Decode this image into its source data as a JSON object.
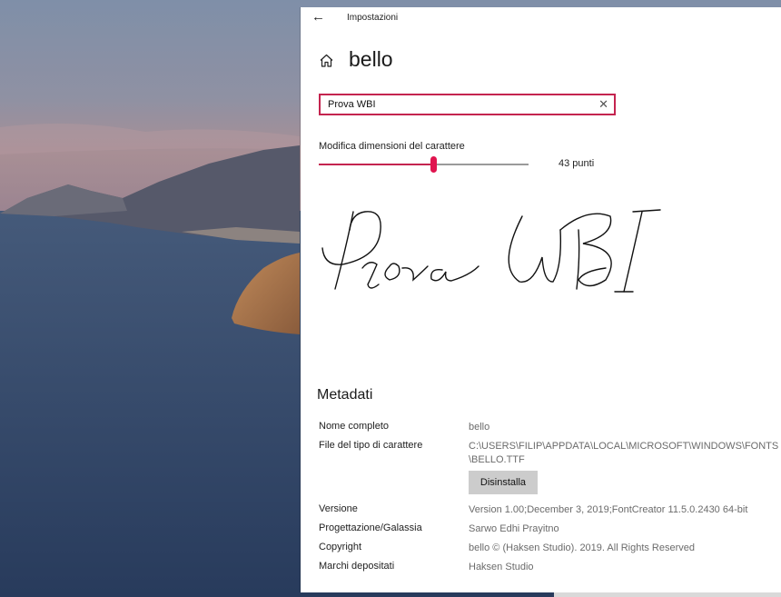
{
  "window": {
    "app_title": "Impostazioni",
    "back_icon": "back-arrow-icon",
    "home_icon": "home-icon"
  },
  "page": {
    "title": "bello"
  },
  "preview_input": {
    "value": "Prova WBI",
    "clear_icon": "close-icon",
    "clear_glyph": "✕",
    "back_glyph": "←"
  },
  "size_slider": {
    "label": "Modifica dimensioni del carattere",
    "value_text": "43 punti",
    "value": 43,
    "fraction": 0.545
  },
  "preview": {
    "text": "Prova WBI"
  },
  "metadata": {
    "title": "Metadati",
    "rows": [
      {
        "key": "Nome completo",
        "value": "bello"
      },
      {
        "key": "File del tipo di carattere",
        "value": "C:\\USERS\\FILIP\\APPDATA\\LOCAL\\MICROSOFT\\WINDOWS\\FONTS",
        "value2": "\\BELLO.TTF"
      },
      {
        "key": "Versione",
        "value": "Version 1.00;December 3, 2019;FontCreator 11.5.0.2430 64-bit"
      },
      {
        "key": "Progettazione/Galassia",
        "value": "Sarwo Edhi Prayitno"
      },
      {
        "key": "Copyright",
        "value": "bello © (Haksen Studio). 2019. All Rights Reserved"
      },
      {
        "key": "Marchi depositati",
        "value": "Haksen Studio"
      }
    ],
    "uninstall_label": "Disinstalla"
  },
  "colors": {
    "accent": "#c4244f",
    "thumb": "#e0144f",
    "button_bg": "#cccccc"
  }
}
